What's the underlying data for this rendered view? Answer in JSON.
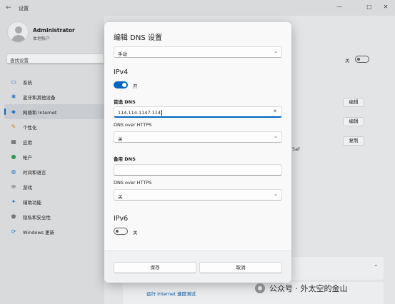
{
  "window": {
    "title": "设置",
    "back": "←",
    "minimize": "—",
    "maximize": "□",
    "close": "✕"
  },
  "profile": {
    "name": "Administrator",
    "type": "本地帐户"
  },
  "search": {
    "placeholder": "查找设置"
  },
  "nav": [
    {
      "label": "系统",
      "icon": "monitor-icon",
      "glyph": "▭",
      "color": "#2b7cd3"
    },
    {
      "label": "蓝牙和其他设备",
      "icon": "bluetooth-icon",
      "glyph": "✱",
      "color": "#2b7cd3"
    },
    {
      "label": "网络和 Internet",
      "icon": "wifi-icon",
      "glyph": "◆",
      "color": "#2b7cd3",
      "active": true
    },
    {
      "label": "个性化",
      "icon": "brush-icon",
      "glyph": "✎",
      "color": "#d08a2a"
    },
    {
      "label": "应用",
      "icon": "apps-icon",
      "glyph": "▦",
      "color": "#555555"
    },
    {
      "label": "帐户",
      "icon": "account-icon",
      "glyph": "●",
      "color": "#2b9a55"
    },
    {
      "label": "时间和语言",
      "icon": "globe-clock-icon",
      "glyph": "◍",
      "color": "#2b7cd3"
    },
    {
      "label": "游戏",
      "icon": "gamepad-icon",
      "glyph": "⊕",
      "color": "#777777"
    },
    {
      "label": "辅助功能",
      "icon": "accessibility-icon",
      "glyph": "✦",
      "color": "#2b7cd3"
    },
    {
      "label": "隐私和安全性",
      "icon": "shield-icon",
      "glyph": "⬟",
      "color": "#777777"
    },
    {
      "label": "Windows 更新",
      "icon": "windows-update-icon",
      "glyph": "⟳",
      "color": "#2b7cd3"
    }
  ],
  "background_right": {
    "toggle_label": "关",
    "edit1": "编辑",
    "edit2": "编辑",
    "copy": "复制",
    "partial_text": "5af",
    "speed_test": "运行 Internet 速度测试",
    "chevron": "⌃"
  },
  "dialog": {
    "title": "编辑 DNS 设置",
    "mode": "手动",
    "ipv4": {
      "heading": "IPv4",
      "toggle_label": "开",
      "preferred_label": "首选 DNS",
      "preferred_value": "114.114.1147.114",
      "preferred_doh_label": "DNS over HTTPS",
      "preferred_doh_value": "关",
      "alternate_label": "备用 DNS",
      "alternate_value": "",
      "alternate_doh_label": "DNS over HTTPS",
      "alternate_doh_value": "关"
    },
    "ipv6": {
      "heading": "IPv6",
      "toggle_label": "关"
    },
    "save": "保存",
    "cancel": "取消"
  },
  "watermark": "公众号 · 外太空的金山"
}
